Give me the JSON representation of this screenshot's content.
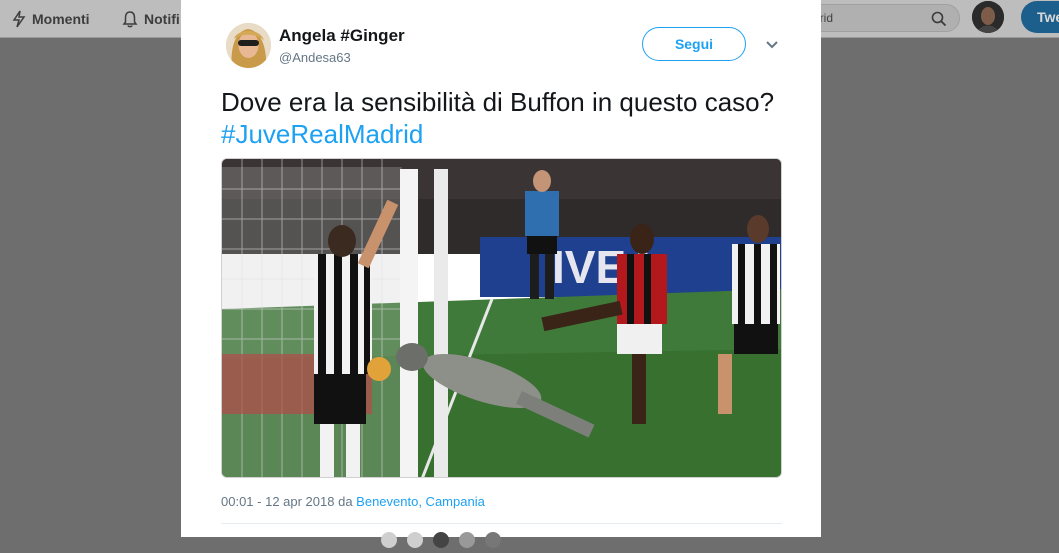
{
  "nav": {
    "moments_label": "Momenti",
    "notifications_label": "Notifi",
    "search_value": "drid",
    "tweet_button_label": "Twe"
  },
  "tweet": {
    "author_name": "Angela #Ginger",
    "author_handle": "@Andesa63",
    "follow_label": "Segui",
    "text_main": "Dove era la sensibilità di Buffon in questo caso? ",
    "hashtag": "#JuveRealMadrid",
    "timestamp": "00:01 - 12 apr 2018 da ",
    "location": "Benevento, Campania"
  },
  "colors": {
    "accent": "#1da1f2",
    "overlay": "#6e6e6e",
    "pitch": "#3f7a3a"
  },
  "icons": {
    "moments": "lightning-icon",
    "notifications": "bell-icon",
    "search": "search-icon",
    "more": "chevron-down-icon"
  }
}
